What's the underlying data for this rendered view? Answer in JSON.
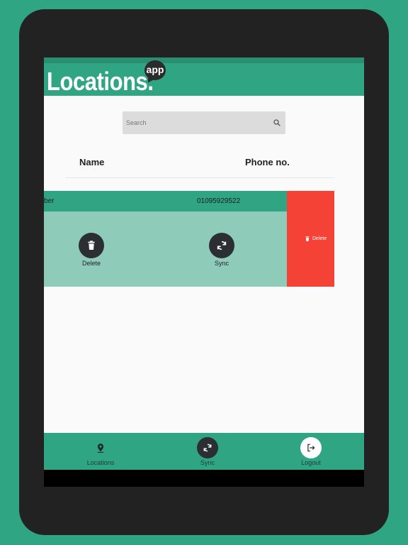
{
  "app": {
    "logo_main": "Locations.",
    "logo_badge": "app"
  },
  "search": {
    "placeholder": "Search"
  },
  "table": {
    "headers": {
      "name": "Name",
      "phone": "Phone no."
    },
    "rows": [
      {
        "name": "ber",
        "phone": "01095929522"
      }
    ]
  },
  "row_actions": {
    "delete_label": "Delete",
    "sync_label": "Sync"
  },
  "swipe": {
    "delete_label": "Delete"
  },
  "bottom_nav": {
    "items": [
      {
        "label": "Locations",
        "icon": "location-pin-icon"
      },
      {
        "label": "Sync",
        "icon": "sync-icon"
      },
      {
        "label": "Logout",
        "icon": "logout-icon"
      }
    ]
  },
  "colors": {
    "brand": "#2fa583",
    "panel": "#8ecbb9",
    "danger": "#f44336",
    "dark": "#2b2e33"
  }
}
